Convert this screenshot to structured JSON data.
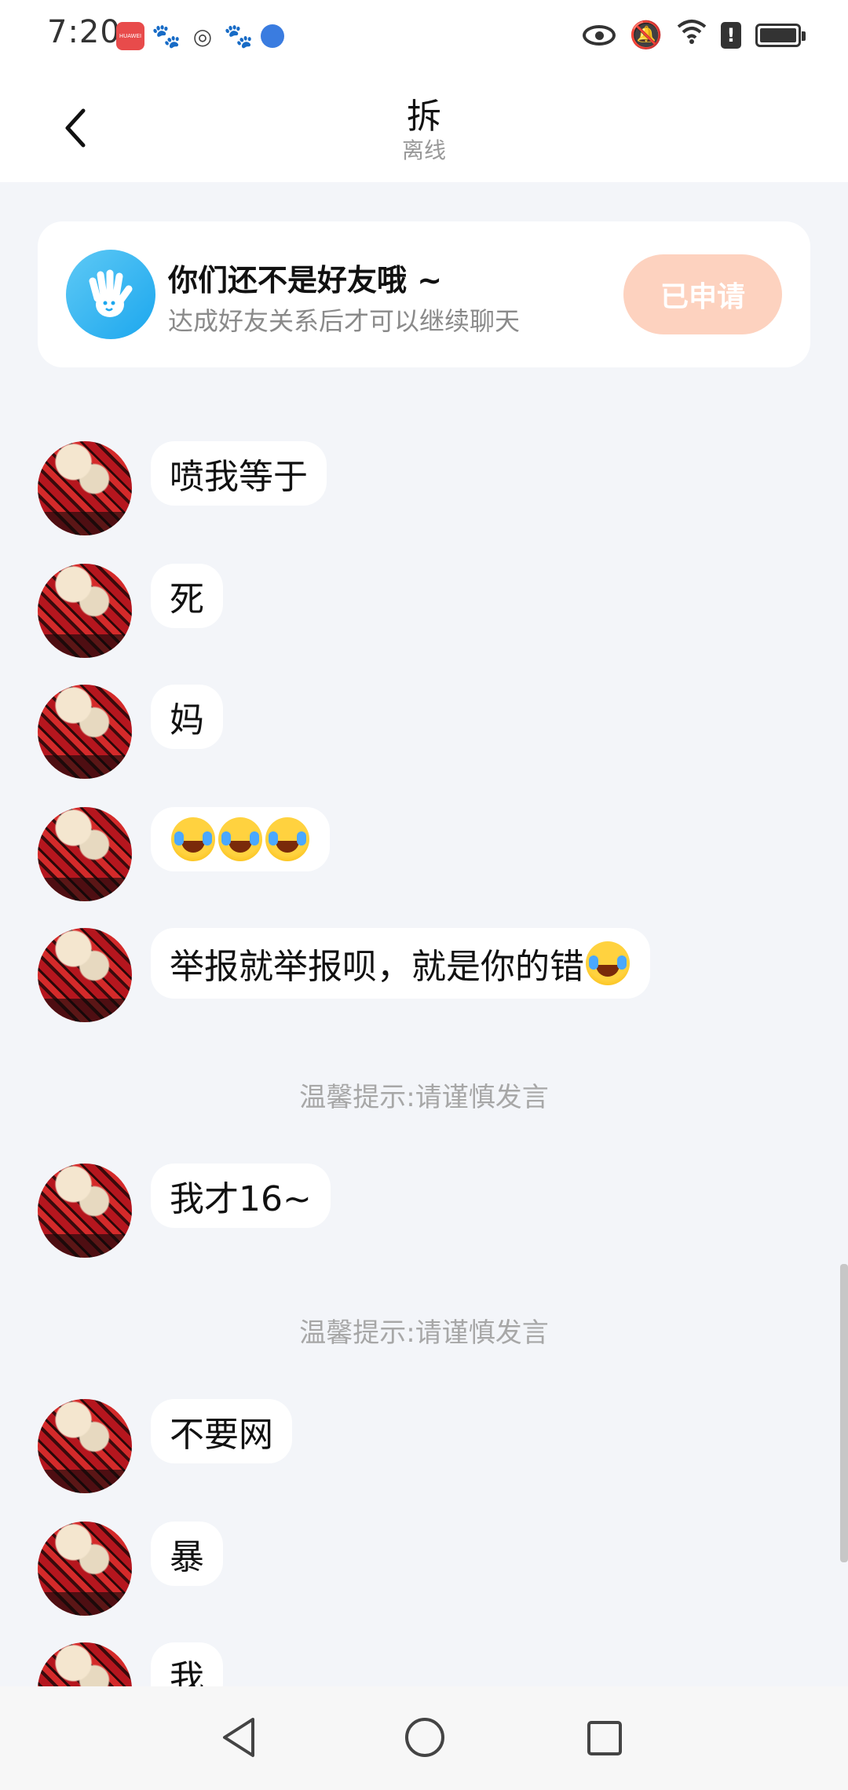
{
  "status_bar": {
    "time": "7:20",
    "left_icons": [
      "huawei-appgallery-icon",
      "baidu-paw-icon",
      "target-icon",
      "baidu-paw-icon",
      "globe-icon"
    ],
    "right_icons": [
      "eye-icon",
      "bell-muted-icon",
      "wifi-icon",
      "alert-icon",
      "battery-icon"
    ],
    "huawei_label": "HUAWEI"
  },
  "header": {
    "title": "拆",
    "subtitle": "离线"
  },
  "friend_card": {
    "title": "你们还不是好友哦 ~",
    "subtitle": "达成好友关系后才可以继续聊天",
    "button_label": "已申请"
  },
  "tip_text": "温馨提示:请谨慎发言",
  "messages": [
    {
      "text": "喷我等于"
    },
    {
      "text": "死"
    },
    {
      "text": "妈"
    },
    {
      "text": "",
      "emojis": 3
    },
    {
      "text": "举报就举报呗，就是你的错",
      "trailing_emoji": true
    },
    {
      "text": "我才16~"
    },
    {
      "text": "不要网"
    },
    {
      "text": "暴"
    },
    {
      "text": "我"
    }
  ],
  "colors": {
    "background": "#f3f5f9",
    "applied_button": "#fdd2bf",
    "wave_avatar": "#1ca7ee"
  }
}
